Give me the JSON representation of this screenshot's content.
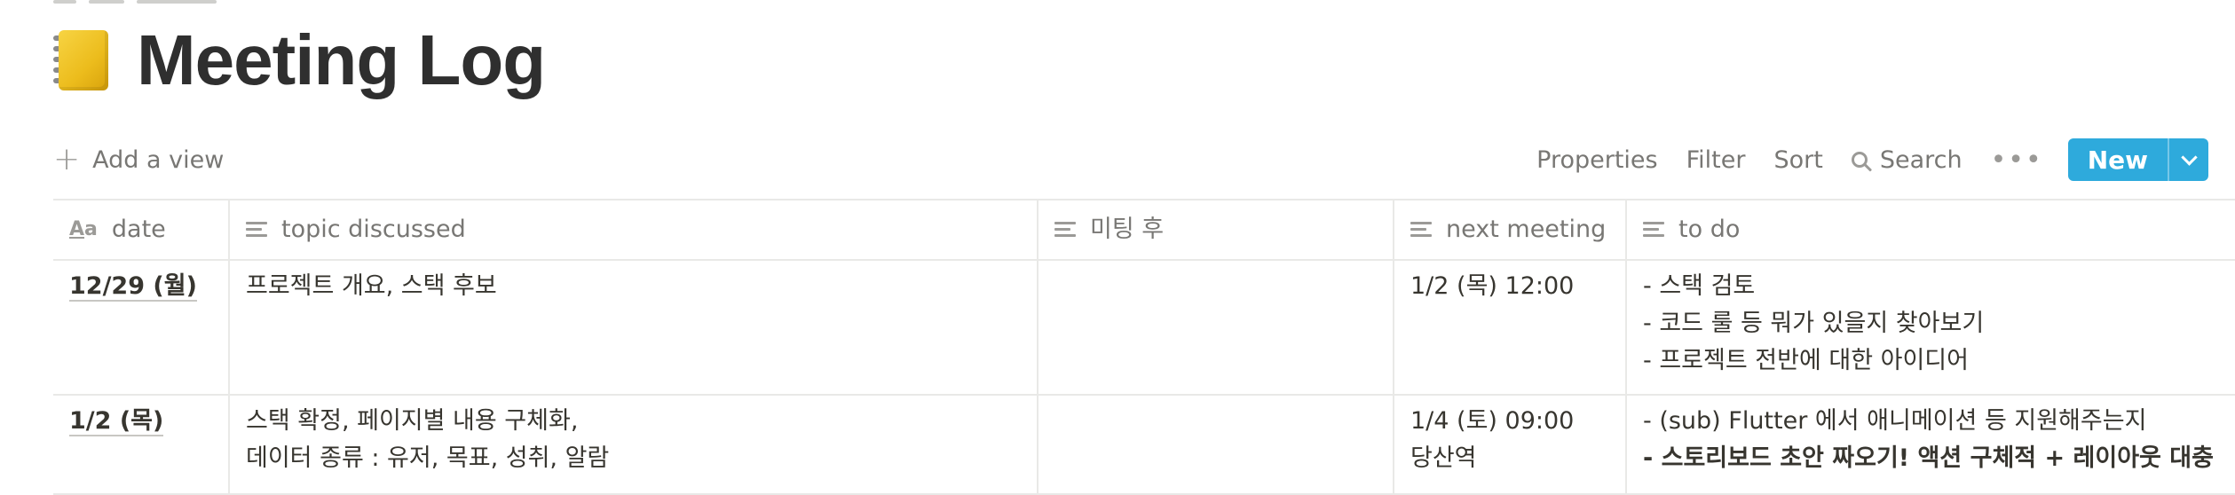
{
  "page": {
    "title": "Meeting Log",
    "icon": "notebook-icon"
  },
  "toolbar": {
    "add_view": "Add a view",
    "properties": "Properties",
    "filter": "Filter",
    "sort": "Sort",
    "search": "Search",
    "more": "•••",
    "new_label": "New",
    "accent": "#2eaadc"
  },
  "table": {
    "columns": [
      {
        "label": "date",
        "icon": "title-property-icon"
      },
      {
        "label": "topic discussed",
        "icon": "text-property-icon"
      },
      {
        "label": "미팅 후",
        "icon": "text-property-icon"
      },
      {
        "label": "next meeting",
        "icon": "text-property-icon"
      },
      {
        "label": "to do",
        "icon": "text-property-icon"
      }
    ],
    "rows": [
      {
        "date": "12/29 (월)",
        "topic": [
          "프로젝트 개요, 스택 후보"
        ],
        "after": "",
        "next": [
          "1/2 (목) 12:00"
        ],
        "todo": [
          "- 스택 검토",
          "- 코드 룰 등 뭐가 있을지 찾아보기",
          "- 프로젝트 전반에 대한 아이디어"
        ]
      },
      {
        "date": "1/2 (목)",
        "topic": [
          "스택 확정, 페이지별 내용 구체화,",
          "데이터 종류 : 유저, 목표, 성취, 알람"
        ],
        "after": "",
        "next": [
          "1/4 (토) 09:00",
          "당산역"
        ],
        "todo": [
          "- (sub) Flutter 에서 애니메이션 등 지원해주는지",
          "- 스토리보드 초안 짜오기! 액션 구체적 + 레이아웃 대충"
        ]
      }
    ]
  }
}
